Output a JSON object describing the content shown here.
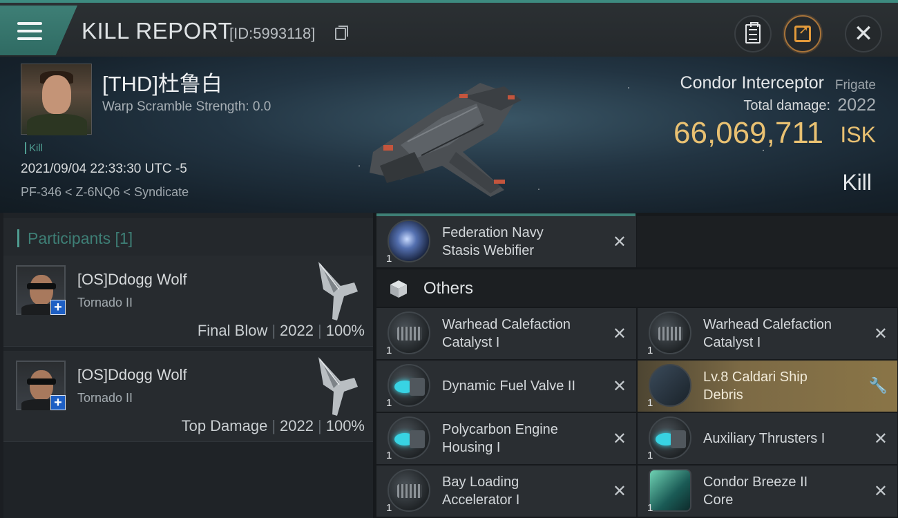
{
  "header": {
    "title": "KILL REPORT",
    "report_id": "[ID:5993118]",
    "icons": [
      "menu-icon",
      "copy-icon",
      "clipboard-icon",
      "share-icon",
      "close-icon"
    ],
    "accent_color": "#3e7f76"
  },
  "victim": {
    "name": "[THD]杜鲁白",
    "warp_scramble": "Warp Scramble Strength: 0.0",
    "tag": "Kill",
    "time": "2021/09/04 22:33:30 UTC -5",
    "location": "PF-346 < Z-6NQ6 < Syndicate",
    "ship_name": "Condor Interceptor",
    "ship_class": "Frigate",
    "damage_label": "Total damage:",
    "damage_value": "2022",
    "isk_value": "66,069,711",
    "isk_unit": "ISK",
    "status": "Kill",
    "isk_color": "#e9c172"
  },
  "participants": {
    "title": "Participants [1]",
    "rows": [
      {
        "name": "[OS]Ddogg Wolf",
        "ship": "Tornado II",
        "label": "Final Blow",
        "damage": "2022",
        "percent": "100%"
      },
      {
        "name": "[OS]Ddogg Wolf",
        "ship": "Tornado II",
        "label": "Top Damage",
        "damage": "2022",
        "percent": "100%"
      }
    ]
  },
  "items": {
    "top": {
      "qty": "1",
      "name_line1": "Federation Navy",
      "name_line2": "Stasis Webifier"
    },
    "others_title": "Others",
    "list": [
      {
        "qty": "1",
        "line1": "Warhead Calefaction",
        "line2": "Catalyst I",
        "icon": "catalyst"
      },
      {
        "qty": "1",
        "line1": "Warhead Calefaction",
        "line2": "Catalyst I",
        "icon": "catalyst"
      },
      {
        "qty": "1",
        "line1": "Dynamic Fuel Valve II",
        "line2": "",
        "icon": "thruster"
      },
      {
        "qty": "1",
        "line1": "Lv.8 Caldari Ship",
        "line2": "Debris",
        "icon": "debris"
      },
      {
        "qty": "1",
        "line1": "Polycarbon Engine",
        "line2": "Housing I",
        "icon": "thruster"
      },
      {
        "qty": "1",
        "line1": "Auxiliary Thrusters I",
        "line2": "",
        "icon": "thruster"
      },
      {
        "qty": "1",
        "line1": "Bay Loading",
        "line2": "Accelerator I",
        "icon": "catalyst"
      },
      {
        "qty": "1",
        "line1": "Condor Breeze II",
        "line2": "Core",
        "icon": "core"
      }
    ]
  }
}
